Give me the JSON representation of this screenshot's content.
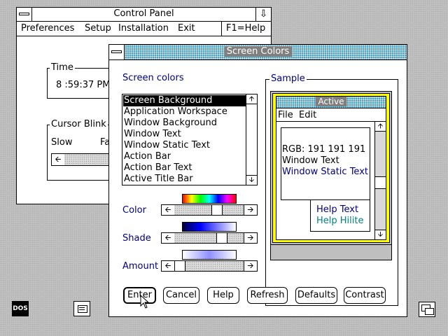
{
  "control_panel": {
    "title": "Control Panel",
    "menu": {
      "preferences": "Preferences",
      "setup": "Setup",
      "installation": "Installation",
      "exit": "Exit",
      "help_key": "F1=Help"
    },
    "time": {
      "label": "Time",
      "value": "8 :59:37 PM"
    },
    "cursor_blink": {
      "label": "Cursor Blink",
      "slow": "Slow",
      "fast": "Fa"
    }
  },
  "dialog": {
    "title": "Screen Colors",
    "screen_colors_label": "Screen colors",
    "items": [
      "Screen Background",
      "Application Workspace",
      "Window Background",
      "Window Text",
      "Window Static Text",
      "Action Bar",
      "Action Bar Text",
      "Active Title Bar"
    ],
    "selected_index": 0,
    "sliders": {
      "color": {
        "label": "Color"
      },
      "shade": {
        "label": "Shade"
      },
      "amount": {
        "label": "Amount"
      }
    },
    "sample": {
      "label": "Sample",
      "title": "Active",
      "menu_file": "File",
      "menu_edit": "Edit",
      "rgb": "RGB: 191 191 191",
      "window_text": "Window Text",
      "window_static_text": "Window Static Text",
      "help_text": "Help Text",
      "help_hilite": "Help Hilite"
    },
    "buttons": {
      "enter": "Enter",
      "cancel": "Cancel",
      "help": "Help",
      "refresh": "Refresh",
      "defaults": "Defaults",
      "contrast": "Contrast"
    }
  },
  "desktop": {
    "dos_icon": "DOS"
  },
  "colors": {
    "title_active": "#4aa2c0",
    "static_text": "#000080",
    "help_hilite": "#008080",
    "sample_border": "#ffff00"
  }
}
